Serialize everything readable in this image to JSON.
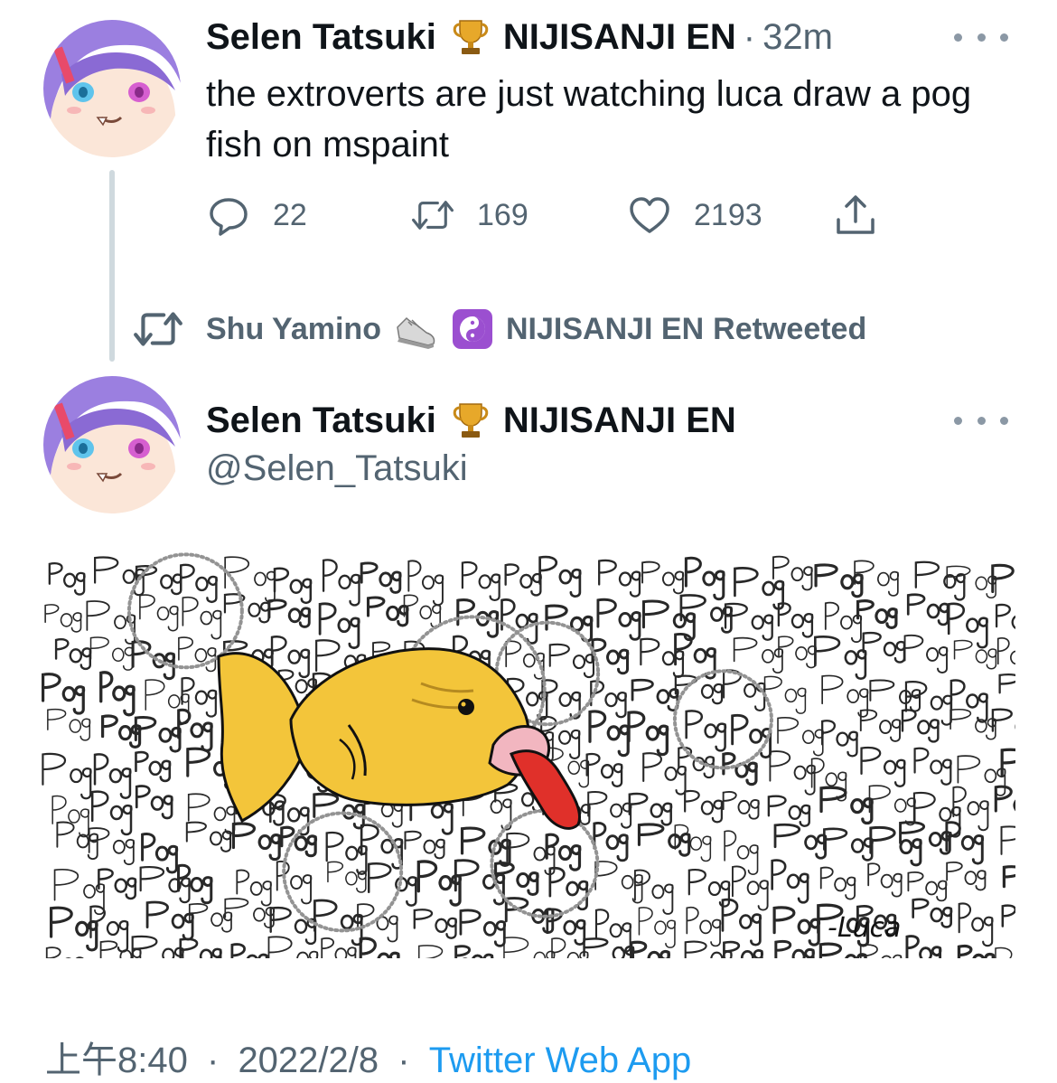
{
  "main_tweet": {
    "author_name": "Selen Tatsuki",
    "author_org": "NIJISANJI EN",
    "separator": "·",
    "time": "32m",
    "text": "the extroverts are just watching luca draw a pog fish on mspaint",
    "reply_count": "22",
    "retweet_count": "169",
    "like_count": "2193"
  },
  "retweet_context": {
    "retweeter_name": "Shu Yamino",
    "retweeter_org": "NIJISANJI EN",
    "suffix": "Retweeted"
  },
  "second_tweet": {
    "author_name": "Selen Tatsuki",
    "author_org": "NIJISANJI EN",
    "handle": "@Selen_Tatsuki",
    "image_signature": "-Luca",
    "date_time": "上午8:40",
    "date": "2022/2/8",
    "separator": "·",
    "source": "Twitter Web App"
  },
  "icons": {
    "reply": "reply-bubble-icon",
    "retweet": "retweet-icon",
    "like": "heart-icon",
    "share": "share-icon",
    "more": "more-dots-icon",
    "badge": "trophy-icon",
    "shoe": "shoe-icon",
    "yinyang": "yin-yang-icon"
  },
  "colors": {
    "text": "#0f1419",
    "muted": "#536471",
    "link": "#1d9bf0",
    "avatar_hair": "#9b7fe0",
    "fish_body": "#f3c53a",
    "tongue": "#e0302a"
  }
}
